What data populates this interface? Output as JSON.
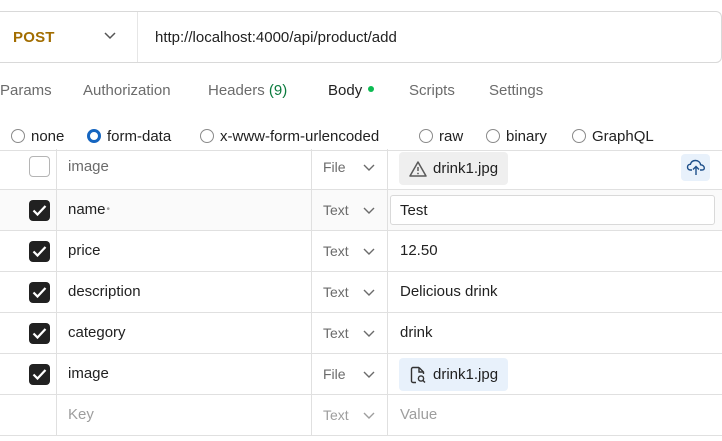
{
  "request": {
    "method": "POST",
    "url": "http://localhost:4000/api/product/add",
    "method_color": "#a26d00"
  },
  "tabs": [
    {
      "label": "Params"
    },
    {
      "label": "Authorization"
    },
    {
      "label": "Headers",
      "count": "(9)"
    },
    {
      "label": "Body",
      "active": true
    },
    {
      "label": "Scripts"
    },
    {
      "label": "Settings"
    }
  ],
  "body_types": [
    {
      "label": "none",
      "checked": false
    },
    {
      "label": "form-data",
      "checked": true
    },
    {
      "label": "x-www-form-urlencoded",
      "checked": false
    },
    {
      "label": "raw",
      "checked": false
    },
    {
      "label": "binary",
      "checked": false
    },
    {
      "label": "GraphQL",
      "checked": false
    }
  ],
  "form_rows": [
    {
      "checked": false,
      "key": "image",
      "type": "File",
      "value": "drink1.jpg",
      "value_kind": "file-warning"
    },
    {
      "checked": true,
      "key": "name",
      "type": "Text",
      "value": "Test",
      "value_kind": "input"
    },
    {
      "checked": true,
      "key": "price",
      "type": "Text",
      "value": "12.50",
      "value_kind": "text"
    },
    {
      "checked": true,
      "key": "description",
      "type": "Text",
      "value": "Delicious drink",
      "value_kind": "text"
    },
    {
      "checked": true,
      "key": "category",
      "type": "Text",
      "value": "drink",
      "value_kind": "text"
    },
    {
      "checked": true,
      "key": "image",
      "type": "File",
      "value": "drink1.jpg",
      "value_kind": "file"
    }
  ],
  "new_row": {
    "key_placeholder": "Key",
    "type": "Text",
    "value_placeholder": "Value"
  },
  "colors": {
    "accent_blue": "#1565c0",
    "active_dot": "#0cbb52",
    "checkbox": "#212121"
  }
}
